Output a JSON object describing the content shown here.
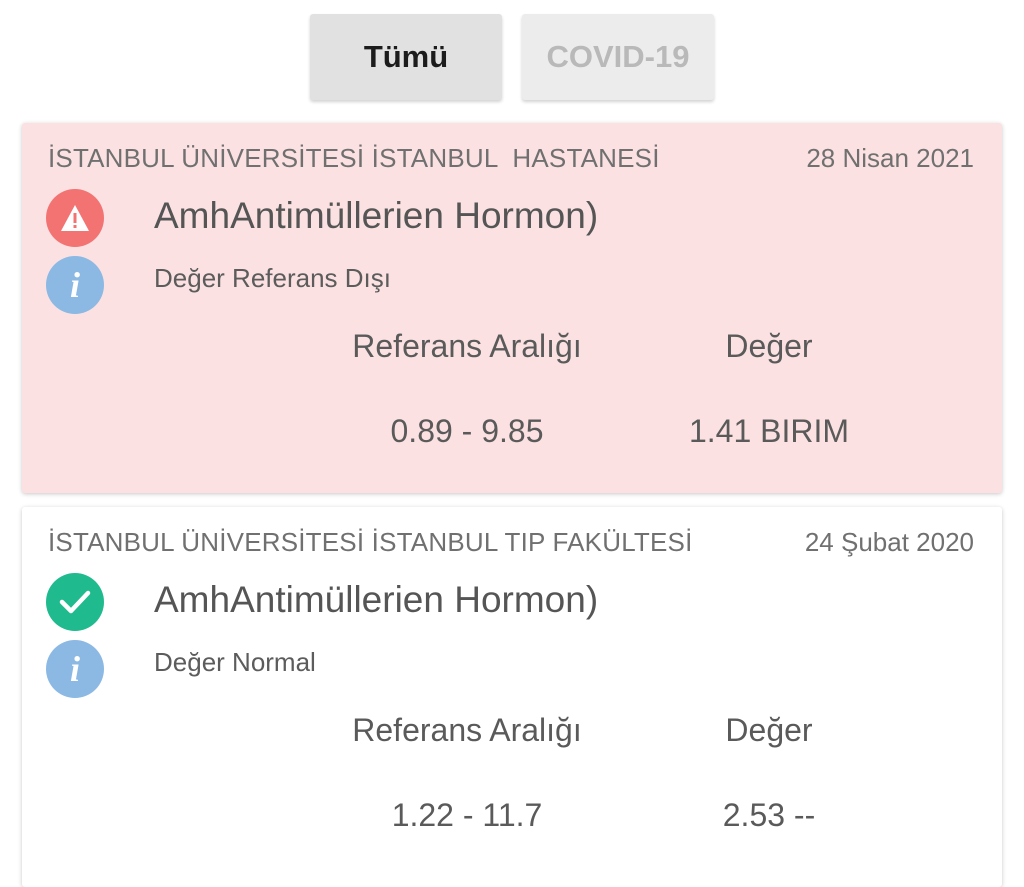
{
  "filters": {
    "all_label": "Tümü",
    "covid_label": "COVID-19"
  },
  "results": [
    {
      "institution": "İSTANBUL ÜNİVERSİTESİ İSTANBUL  HASTANESİ",
      "date": "28 Nisan 2021",
      "test_name": "AmhAntimüllerien Hormon)",
      "status_icon": "warning-icon",
      "status_text": "Değer Referans Dışı",
      "reference_header": "Referans Aralığı",
      "value_header": "Değer",
      "reference_range": "0.89 - 9.85",
      "value": "1.41 BIRIM",
      "background": "#fbe1e1"
    },
    {
      "institution": "İSTANBUL ÜNİVERSİTESİ İSTANBUL TIP FAKÜLTESİ",
      "date": "24 Şubat 2020",
      "test_name": "AmhAntimüllerien Hormon)",
      "status_icon": "check-icon",
      "status_text": "Değer Normal",
      "reference_header": "Referans Aralığı",
      "value_header": "Değer",
      "reference_range": "1.22 - 11.7",
      "value": "2.53 --",
      "background": "#ffffff"
    }
  ],
  "colors": {
    "warning": "#f37373",
    "ok": "#1fbb8e",
    "info": "#8bb9e4"
  }
}
